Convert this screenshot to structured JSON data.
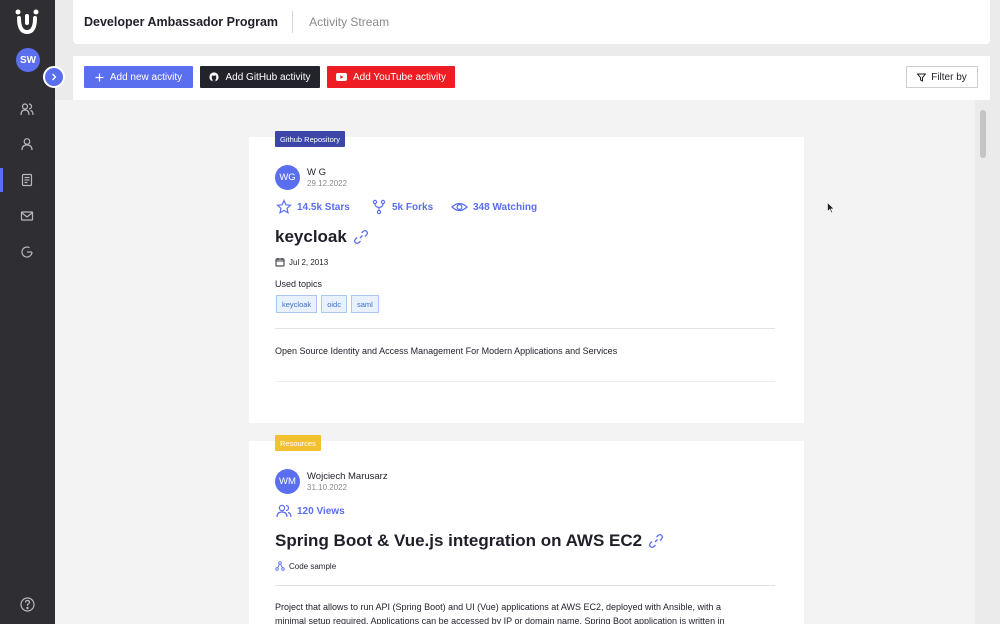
{
  "sidebar": {
    "avatar_initials": "SW",
    "nav_icons": [
      "users-icon",
      "user-icon",
      "document-icon",
      "mail-icon",
      "refresh-icon"
    ]
  },
  "header": {
    "title": "Developer Ambassador Program",
    "subtitle": "Activity Stream"
  },
  "toolbar": {
    "add_new": "Add new activity",
    "add_github": "Add GitHub activity",
    "add_youtube": "Add YouTube activity",
    "filter": "Filter by"
  },
  "colors": {
    "accent": "#5a6ef0",
    "github": "#23232b",
    "youtube": "#ee1d23",
    "resource_tag": "#f3c030",
    "github_tag": "#3b46a8"
  },
  "cards": [
    {
      "tag": "Github Repository",
      "author_initials": "WG",
      "author_name": "W G",
      "date": "29.12.2022",
      "stars": "14.5k Stars",
      "forks": "5k Forks",
      "watching": "348 Watching",
      "title": "keycloak",
      "created": "Jul 2, 2013",
      "topics_label": "Used topics",
      "topics": [
        "keycloak",
        "oidc",
        "saml"
      ],
      "description": "Open Source Identity and Access Management For Modern Applications and Services"
    },
    {
      "tag": "Resources",
      "author_initials": "WM",
      "author_name": "Wojciech Marusarz",
      "date": "31.10.2022",
      "views": "120 Views",
      "title": "Spring Boot & Vue.js integration on AWS EC2",
      "category": "Code sample",
      "description_line1": "Project that allows to run API (Spring Boot) and UI (Vue) applications at AWS EC2, deployed with Ansible, with a",
      "description_line2": "minimal setup required. Applications can be accessed by IP or domain name. Spring Boot application is written in"
    }
  ]
}
